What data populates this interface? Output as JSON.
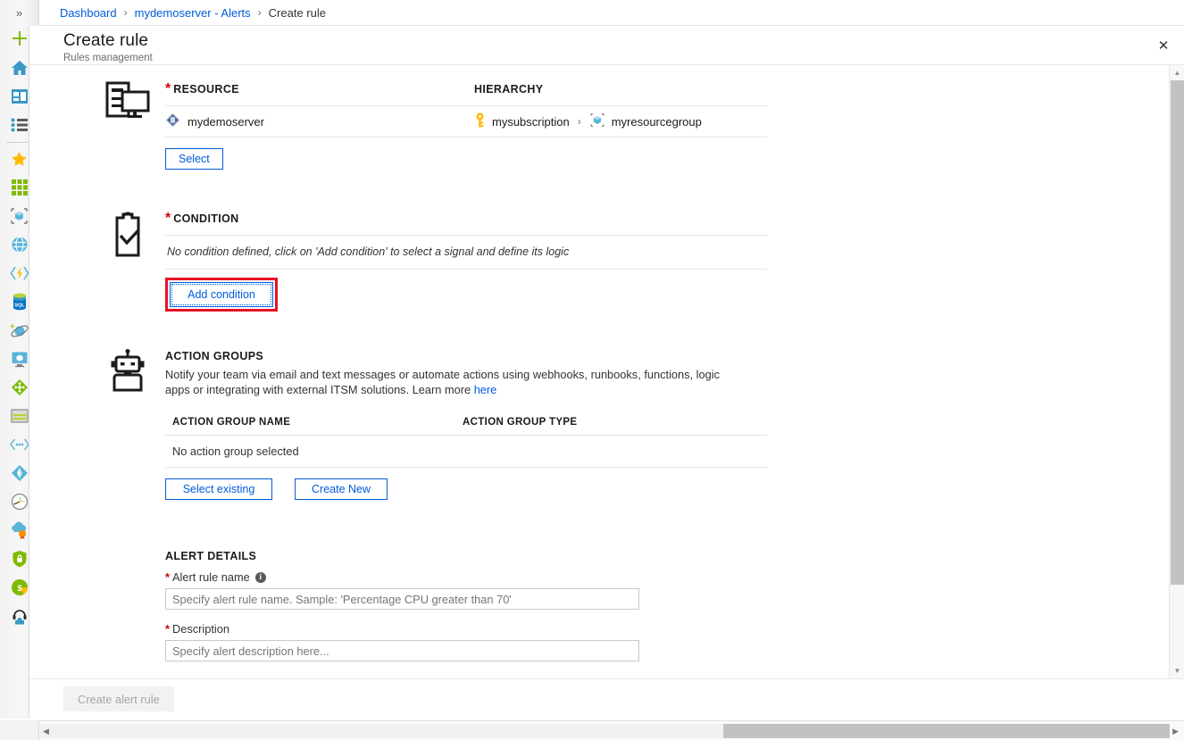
{
  "rail": {
    "toggle_label": "»",
    "items": [
      {
        "name": "create-resource-icon",
        "glyph": "plus"
      },
      {
        "name": "home-icon",
        "glyph": "home"
      },
      {
        "name": "dashboard-icon",
        "glyph": "dashboard"
      },
      {
        "name": "all-services-icon",
        "glyph": "list"
      },
      {
        "name": "favorites-star-icon",
        "glyph": "star"
      },
      {
        "name": "all-resources-icon",
        "glyph": "grid"
      },
      {
        "name": "resource-groups-icon",
        "glyph": "cube"
      },
      {
        "name": "app-services-icon",
        "glyph": "globe"
      },
      {
        "name": "function-apps-icon",
        "glyph": "function"
      },
      {
        "name": "sql-databases-icon",
        "glyph": "sql"
      },
      {
        "name": "azure-cosmos-db-icon",
        "glyph": "cosmos"
      },
      {
        "name": "virtual-machines-icon",
        "glyph": "vm"
      },
      {
        "name": "load-balancers-icon",
        "glyph": "loadbalancer"
      },
      {
        "name": "storage-accounts-icon",
        "glyph": "storage"
      },
      {
        "name": "virtual-networks-icon",
        "glyph": "vnet"
      },
      {
        "name": "azure-active-directory-icon",
        "glyph": "aad"
      },
      {
        "name": "monitor-icon",
        "glyph": "monitor"
      },
      {
        "name": "advisor-icon",
        "glyph": "advisor"
      },
      {
        "name": "security-center-icon",
        "glyph": "shield"
      },
      {
        "name": "cost-management-icon",
        "glyph": "cost"
      },
      {
        "name": "help-and-support-icon",
        "glyph": "help"
      }
    ]
  },
  "breadcrumb": {
    "items": [
      "Dashboard",
      "mydemoserver - Alerts",
      "Create rule"
    ],
    "separator": "›"
  },
  "blade": {
    "title": "Create rule",
    "subtitle": "Rules management",
    "close_label": "✕"
  },
  "resource": {
    "section_icon": "server-monitor-icon",
    "required_mark": "*",
    "label": "RESOURCE",
    "hierarchy_label": "HIERARCHY",
    "resource_name": "mydemoserver",
    "resource_icon": "sql-server-resource-icon",
    "hierarchy": [
      {
        "icon": "subscription-key-icon",
        "label": "mysubscription"
      },
      {
        "icon": "resource-group-icon",
        "label": "myresourcegroup"
      }
    ],
    "hierarchy_separator": "›",
    "select_button": "Select"
  },
  "condition": {
    "section_icon": "clipboard-check-icon",
    "required_mark": "*",
    "label": "CONDITION",
    "empty_text": "No condition defined, click on 'Add condition' to select a signal and define its logic",
    "add_button": "Add condition",
    "highlight_color": "#e81123"
  },
  "action_groups": {
    "section_icon": "robot-icon",
    "label": "ACTION GROUPS",
    "description_part1": "Notify your team via email and text messages or automate actions using webhooks, runbooks, functions, logic apps or integrating with external ITSM solutions. Learn more ",
    "description_link": "here",
    "columns": [
      "ACTION GROUP NAME",
      "ACTION GROUP TYPE"
    ],
    "empty_row": "No action group selected",
    "select_existing_button": "Select existing",
    "create_new_button": "Create New"
  },
  "alert_details": {
    "title": "ALERT DETAILS",
    "required_mark": "*",
    "rule_name_label": "Alert rule name",
    "rule_name_info": "i",
    "rule_name_placeholder": "Specify alert rule name. Sample: 'Percentage CPU greater than 70'",
    "rule_name_value": "",
    "description_label": "Description",
    "description_placeholder": "Specify alert description here...",
    "description_value": ""
  },
  "footer": {
    "create_button": "Create alert rule"
  },
  "scrollbars": {
    "v_up": "▲",
    "v_down": "▼",
    "h_left": "◀",
    "h_right": "▶"
  },
  "colors": {
    "accent": "#015cda",
    "required": "#d40000",
    "highlight": "#e81123"
  }
}
